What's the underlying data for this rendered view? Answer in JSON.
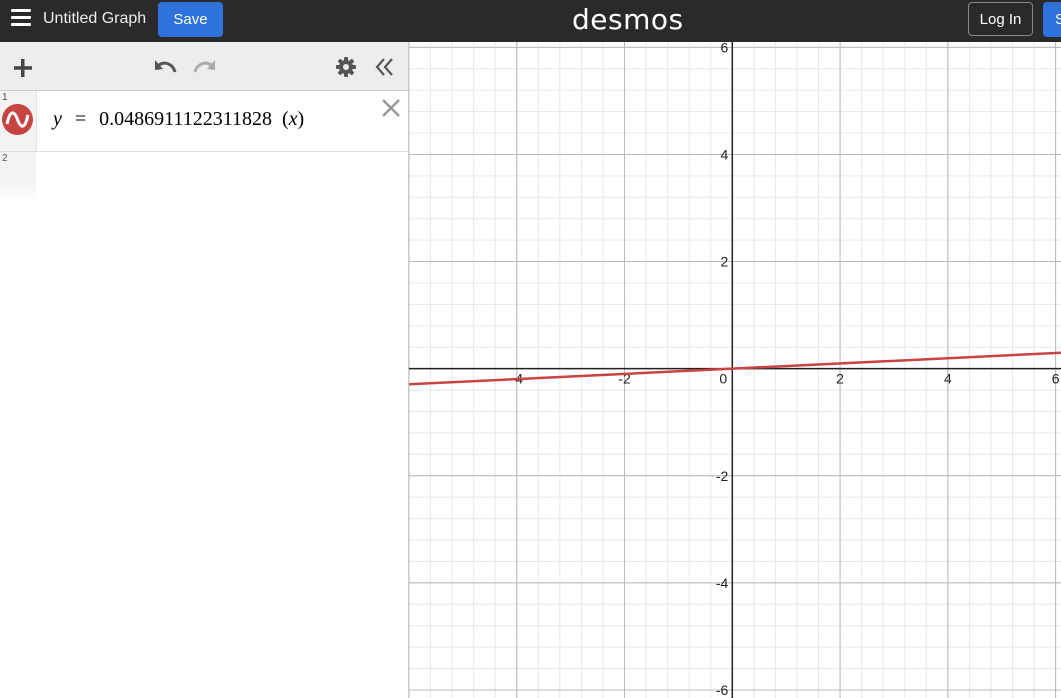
{
  "header": {
    "title": "Untitled Graph",
    "save_label": "Save",
    "logo": "desmos",
    "login_label": "Log In",
    "signup_label": "S"
  },
  "toolbar": {
    "icons": [
      "plus-icon",
      "undo-icon",
      "redo-icon",
      "gear-icon",
      "collapse-icon"
    ]
  },
  "expressions": [
    {
      "index": "1",
      "lhs": "y",
      "eq": "=",
      "coef": "0.0486911122311828",
      "arg": "x",
      "color": "#c74440"
    },
    {
      "index": "2"
    }
  ],
  "graph": {
    "x_ticks": [
      "-4",
      "-2",
      "0",
      "2",
      "4",
      "6"
    ],
    "y_ticks": [
      "6",
      "4",
      "2",
      "-2",
      "-4",
      "-6"
    ],
    "xlim": [
      -6.0,
      6.1
    ],
    "ylim": [
      -6.15,
      6.1
    ],
    "slope": 0.0486911122311828
  }
}
